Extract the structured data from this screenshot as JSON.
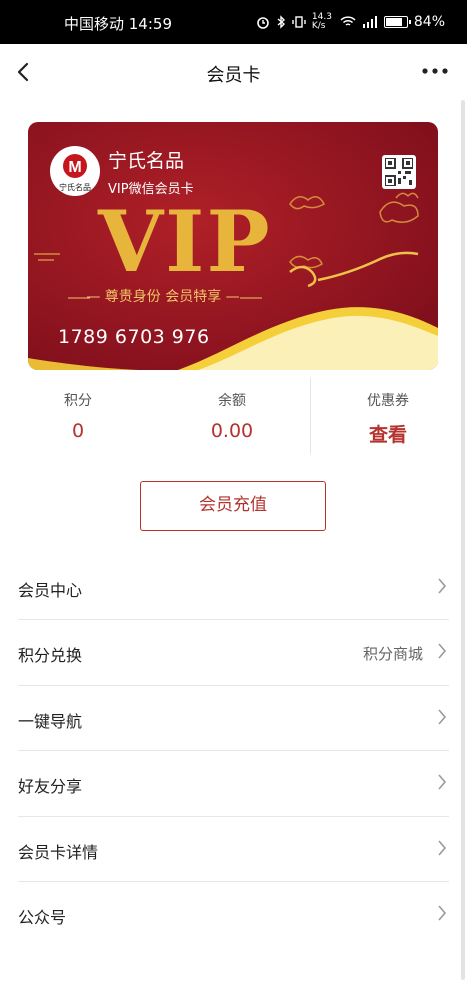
{
  "status_bar": {
    "carrier_time": "中国移动 14:59",
    "network_speed": "14.3 K/s",
    "battery_percent": "84%",
    "battery_level": 0.84,
    "icons": [
      "alarm-icon",
      "bluetooth-icon",
      "vibrate-icon",
      "wifi-icon",
      "signal-4g-icon",
      "battery-icon"
    ]
  },
  "navbar": {
    "title": "会员卡",
    "back_icon": "chevron-left-icon",
    "more_icon": "more-dots-icon"
  },
  "card": {
    "brand": "宁氏名品",
    "subtitle": "VIP微信会员卡",
    "vip_text": "VIP",
    "slogan": "— 尊贵身份  会员特享 —",
    "card_number": "1789 6703 976",
    "logo_text": "宁氏名品",
    "logo_letter": "M",
    "colors": {
      "primary": "#8e1420",
      "gold": "#e7b53c",
      "cream": "#fbf0b8"
    }
  },
  "stats": {
    "points": {
      "label": "积分",
      "value": "0"
    },
    "balance": {
      "label": "余额",
      "value": "0.00"
    },
    "coupon": {
      "label": "优惠券",
      "value": "查看"
    }
  },
  "recharge_button": "会员充值",
  "menu": [
    {
      "label": "会员中心",
      "extra": ""
    },
    {
      "label": "积分兑换",
      "extra": "积分商城"
    },
    {
      "label": "一键导航",
      "extra": ""
    },
    {
      "label": "好友分享",
      "extra": ""
    },
    {
      "label": "会员卡详情",
      "extra": ""
    },
    {
      "label": "公众号",
      "extra": ""
    }
  ],
  "accent_color": "#b5332e"
}
